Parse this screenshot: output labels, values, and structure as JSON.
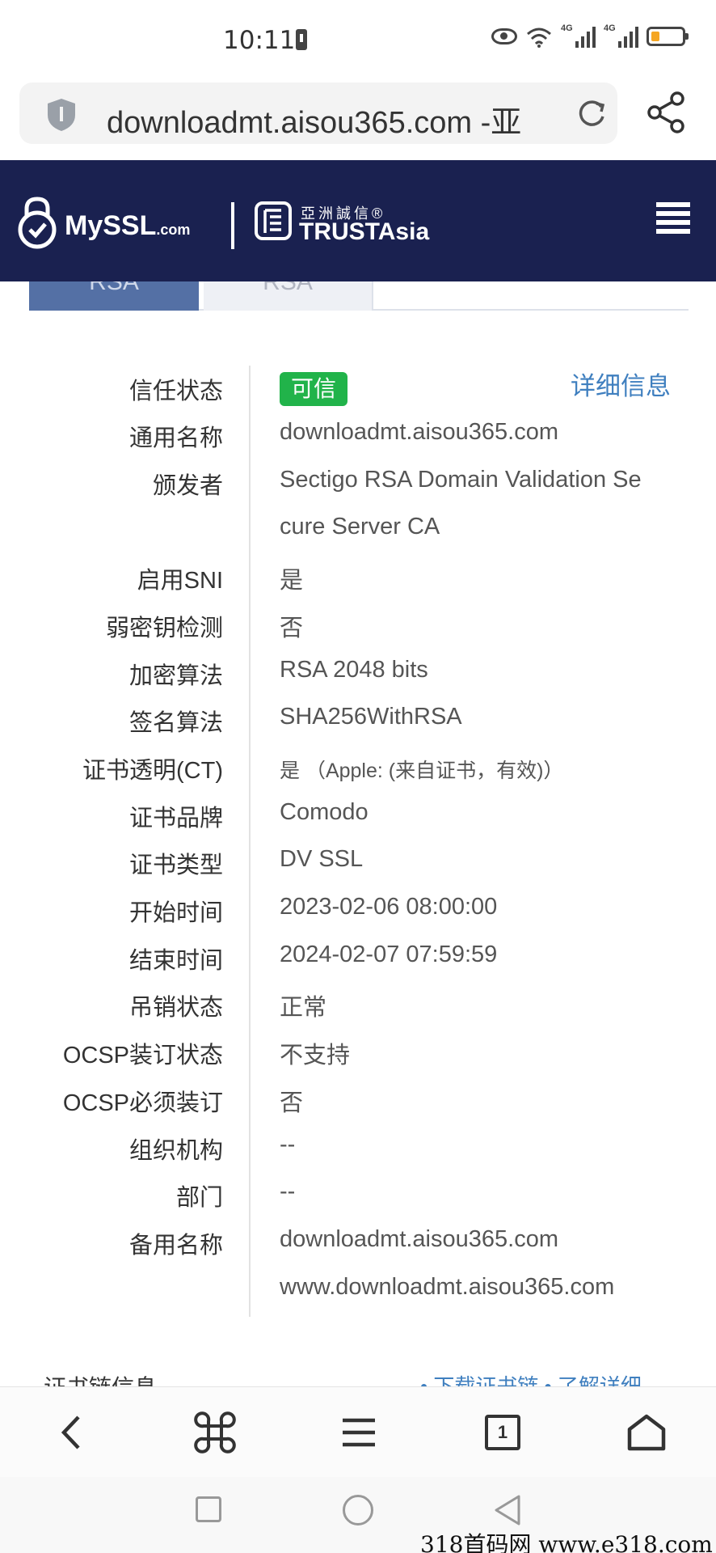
{
  "status_bar": {
    "time": "10:11",
    "network_tag_1": "4G",
    "network_tag_2": "4G"
  },
  "url_bar": {
    "url": "downloadmt.aisou365.com -亚"
  },
  "site_header": {
    "myssl_brand": "MySSL",
    "myssl_suffix": ".com",
    "trust_cn": "亞洲誠信®",
    "trust_en": "TRUSTAsia"
  },
  "tabs": [
    {
      "label": "RSA",
      "active": true
    },
    {
      "label": "RSA",
      "active": false
    }
  ],
  "cert_info": {
    "detail_link": "详细信息",
    "trust_status_label": "信任状态",
    "trust_status_value": "可信",
    "trust_status_color": "#21b34a",
    "rows": [
      {
        "label": "通用名称",
        "value": "downloadmt.aisou365.com"
      },
      {
        "label": "颁发者",
        "value": "Sectigo RSA Domain Validation Se"
      },
      {
        "label": "",
        "value": "cure Server CA"
      },
      {
        "label": "启用SNI",
        "value": "是"
      },
      {
        "label": "弱密钥检测",
        "value": "否"
      },
      {
        "label": "加密算法",
        "value": "RSA 2048 bits"
      },
      {
        "label": "签名算法",
        "value": "SHA256WithRSA"
      },
      {
        "label": "证书透明(CT)",
        "value": "是 （Apple: (来自证书，有效)）"
      },
      {
        "label": "证书品牌",
        "value": "Comodo"
      },
      {
        "label": "证书类型",
        "value": "DV SSL"
      },
      {
        "label": "开始时间",
        "value": "2023-02-06 08:00:00"
      },
      {
        "label": "结束时间",
        "value": "2024-02-07 07:59:59"
      },
      {
        "label": "吊销状态",
        "value": "正常"
      },
      {
        "label": "OCSP装订状态",
        "value": "不支持"
      },
      {
        "label": "OCSP必须装订",
        "value": "否"
      },
      {
        "label": "组织机构",
        "value": "--"
      },
      {
        "label": "部门",
        "value": "--"
      },
      {
        "label": "备用名称",
        "value": "downloadmt.aisou365.com"
      },
      {
        "label": "",
        "value": "www.downloadmt.aisou365.com"
      }
    ]
  },
  "chain_section": {
    "title": "证书链信息",
    "links": "• 下载证书链   • 了解详细"
  },
  "browser_toolbar": {
    "tabs_count": "1"
  },
  "watermark": "318首码网  www.e318.com",
  "colors": {
    "header_bg": "#1a2150",
    "link": "#3f7fbf",
    "active_tab": "#5470a5"
  }
}
